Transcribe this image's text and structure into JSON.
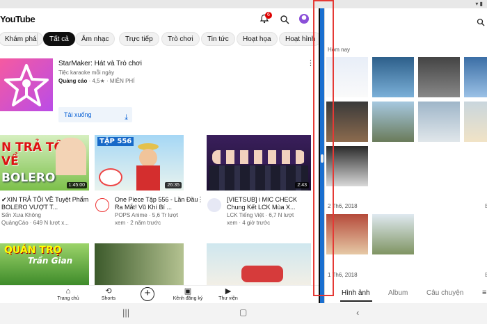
{
  "youtube": {
    "logo": "YouTube",
    "notification_count": "6",
    "chips": [
      "Khám phá",
      "Tất cả",
      "Âm nhạc",
      "Trực tiếp",
      "Trò chơi",
      "Tin tức",
      "Hoạt họa",
      "Hoạt hình"
    ],
    "ad": {
      "title": "StarMaker: Hát và Trò chơi",
      "subtitle": "Tiệc karaoke mỗi ngày",
      "label": "Quảng cáo",
      "rating": "· 4,5★ · MIỄN PHÍ",
      "button": "Tải xuống"
    },
    "videos": [
      {
        "title": "✔XIN TRẢ TÔI VỀ Tuyệt Phẩm BOLERO VƯỢT T...",
        "channel": "Sến Xưa Không",
        "meta": "QuảngCáo · 649 N lượt x...",
        "duration": "1:45:00",
        "thumb_text": "N TRẢ TÔI VỀ",
        "thumb_text2": "BOLERO"
      },
      {
        "title": "One Piece Tập 556 - Lần Đầu Ra Mắt! Vũ Khí Bí ...",
        "channel": "POPS Anime · 5,6 Tr lượt",
        "meta": "xem · 2 năm trước",
        "duration": "26:35",
        "thumb_text": "TẬP 556"
      },
      {
        "title": "[VIETSUB] i MIC CHECK Chung Kết LCK Mùa X...",
        "channel": "LCK Tiếng Việt · 6,7 N lượt",
        "meta": "xem · 4 giờ trước",
        "duration": "2:43"
      },
      {
        "thumb_text": "QUÁN TRỌ",
        "thumb_text2": "Trần Gian"
      }
    ],
    "nav": [
      "Trang chủ",
      "Shorts",
      "Kênh đăng ký",
      "Thư viện"
    ]
  },
  "gallery": {
    "sections": [
      "Hôm nay",
      "2 Th6, 2018",
      "1 Th6, 2018"
    ],
    "tabs": [
      "Hình ảnh",
      "Album",
      "Câu chuyện"
    ]
  },
  "icons": {
    "notification": "bell-icon",
    "search": "search-icon",
    "account": "avatar-icon",
    "download": "download-icon",
    "home": "home-icon",
    "shorts": "shorts-icon",
    "create": "plus-icon",
    "subscriptions": "subscriptions-icon",
    "library": "library-icon",
    "recents": "recents-icon",
    "system_home": "system-home-icon",
    "back": "back-icon"
  },
  "colors": {
    "divider_accent": "#1a6fd0",
    "highlight_box": "#e53935",
    "youtube_red": "#ff0000"
  }
}
